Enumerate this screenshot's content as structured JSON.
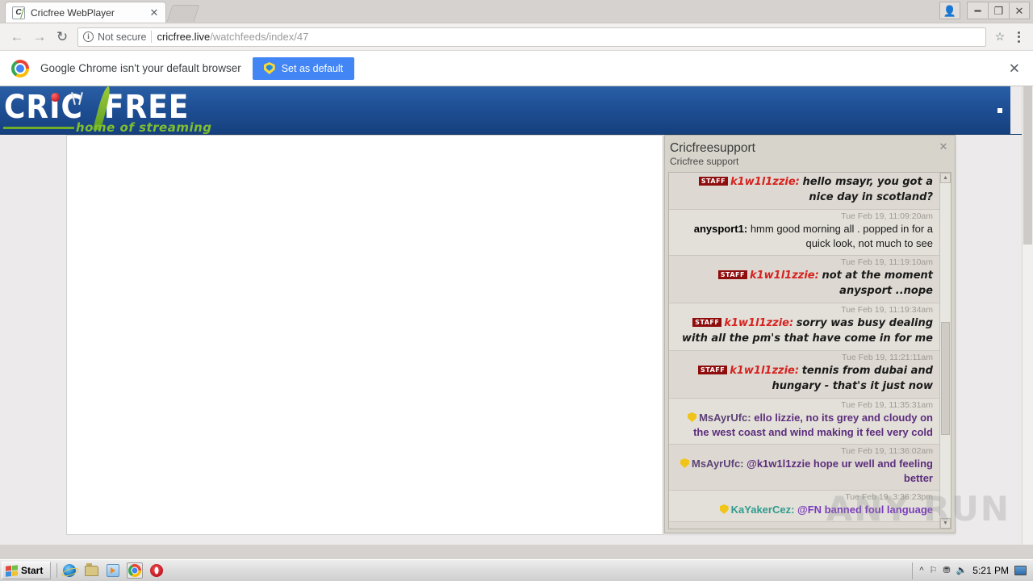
{
  "browser": {
    "tab": {
      "title": "Cricfree WebPlayer",
      "favicon_icon": "cricfree-favicon",
      "close_icon": "close-icon"
    },
    "newtab_icon": "new-tab-icon",
    "window_controls": {
      "profile_icon": "profile-icon",
      "minimize_icon": "minimize-icon",
      "restore_icon": "restore-icon",
      "close_icon": "close-icon"
    },
    "nav": {
      "back_icon": "back-arrow-icon",
      "forward_icon": "forward-arrow-icon",
      "reload_icon": "reload-icon"
    },
    "omnibox": {
      "security_label": "Not secure",
      "security_icon": "info-circle-icon",
      "url_domain": "cricfree.live",
      "url_path": "/watchfeeds/index/47",
      "star_icon": "bookmark-star-icon"
    },
    "menu_icon": "three-dot-menu-icon",
    "infobar": {
      "logo_icon": "chrome-logo-icon",
      "message": "Google Chrome isn't your default browser",
      "button_label": "Set as default",
      "button_icon": "shield-icon",
      "close_icon": "close-icon",
      "button_color": "#4285f4"
    }
  },
  "site": {
    "logo": {
      "text_part1": "CRIC",
      "text_part2": "FREE",
      "tagline": "home of streaming"
    },
    "banner_color": "#1e4f95",
    "accent_green": "#7fbf2f"
  },
  "chat": {
    "title": "Cricfreesupport",
    "subtitle": "Cricfree support",
    "close_icon": "close-icon",
    "scrollbar": {
      "up_icon": "scroll-up-arrow-icon",
      "down_icon": "scroll-down-arrow-icon"
    },
    "messages": [
      {
        "time": "",
        "badge": "STAFF",
        "badge_type": "staff",
        "user": "k1w1l1zzie:",
        "user_style": "staff",
        "body": "hello msayr, you got a nice day in scotland?",
        "body_style": "staff",
        "alt": false
      },
      {
        "time": "Tue Feb 19, 11:09:20am",
        "badge": "",
        "badge_type": "none",
        "user": "anysport1:",
        "user_style": "plain",
        "body": "hmm good morning all . popped in for a quick look, not much to see",
        "body_style": "plain",
        "alt": true
      },
      {
        "time": "Tue Feb 19, 11:19:10am",
        "badge": "STAFF",
        "badge_type": "staff",
        "user": "k1w1l1zzie:",
        "user_style": "staff",
        "body": "not at the moment anysport ..nope",
        "body_style": "staff",
        "alt": false
      },
      {
        "time": "Tue Feb 19, 11:19:34am",
        "badge": "STAFF",
        "badge_type": "staff",
        "user": "k1w1l1zzie:",
        "user_style": "staff",
        "body": "sorry was busy dealing with all the pm's that have come in for me",
        "body_style": "staff",
        "alt": true
      },
      {
        "time": "Tue Feb 19, 11:21:11am",
        "badge": "STAFF",
        "badge_type": "staff",
        "user": "k1w1l1zzie:",
        "user_style": "staff",
        "body": "tennis from dubai and hungary - that's it just now",
        "body_style": "staff",
        "alt": false
      },
      {
        "time": "Tue Feb 19, 11:35:31am",
        "badge": "shield",
        "badge_type": "shield",
        "user": "MsAyrUfc:",
        "user_style": "mod",
        "body": "ello lizzie, no its grey and cloudy on the west coast and wind making it feel very cold",
        "body_style": "mod",
        "alt": true
      },
      {
        "time": "Tue Feb 19, 11:36:02am",
        "badge": "shield",
        "badge_type": "shield",
        "user": "MsAyrUfc:",
        "user_style": "mod",
        "body": "@k1w1l1zzie hope ur well and feeling better",
        "body_style": "mod",
        "alt": false
      },
      {
        "time": "Tue Feb 19, 3:36:23pm",
        "badge": "shield",
        "badge_type": "shield",
        "user": "KaYakerCez:",
        "user_style": "teal",
        "body": "@FN banned foul language",
        "body_style": "purple",
        "alt": true
      }
    ]
  },
  "watermark": {
    "text": "ANY    RUN"
  },
  "taskbar": {
    "start_label": "Start",
    "start_icon": "windows-flag-icon",
    "quicklaunch": [
      {
        "name": "internet-explorer-icon"
      },
      {
        "name": "file-explorer-icon"
      },
      {
        "name": "media-player-icon"
      },
      {
        "name": "chrome-icon"
      },
      {
        "name": "opera-icon"
      }
    ],
    "tray": {
      "show_hidden_icon": "show-hidden-icons-icon",
      "network_icon": "network-icon",
      "security_icon": "security-shield-icon",
      "volume_icon": "volume-icon",
      "clock": "5:21 PM",
      "desktop_icon": "show-desktop-icon"
    }
  }
}
